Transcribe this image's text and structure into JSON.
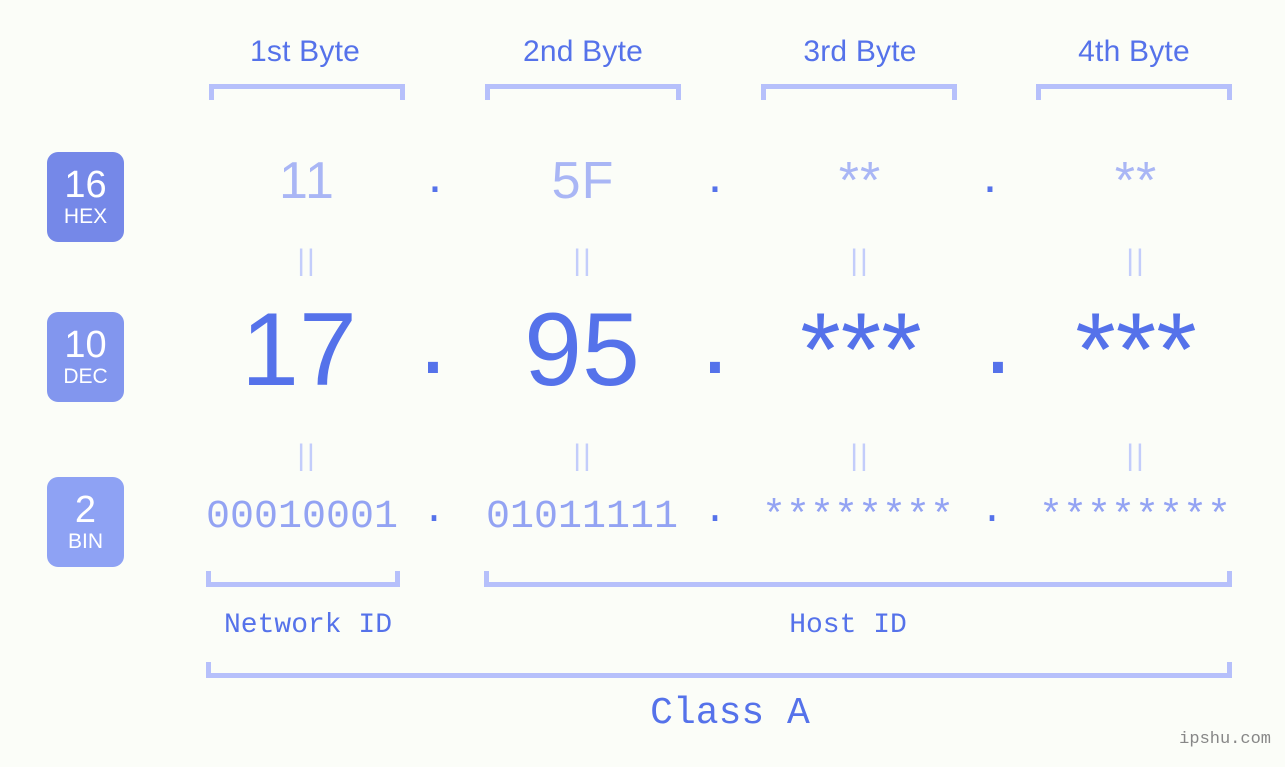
{
  "colors": {
    "background": "#fbfdf8",
    "accent": "#5572ea",
    "accent_light": "#a9b6f5",
    "bracket": "#b6c0fb",
    "connector": "#c3cdfb",
    "badge_hex": "#7588e8",
    "badge_dec": "#8296ee",
    "badge_bin": "#8ea2f4",
    "watermark": "#878787"
  },
  "byte_headers": [
    {
      "label": "1st Byte"
    },
    {
      "label": "2nd Byte"
    },
    {
      "label": "3rd Byte"
    },
    {
      "label": "4th Byte"
    }
  ],
  "rows": [
    {
      "id": "hex",
      "badge_number": "16",
      "badge_label": "HEX",
      "values": [
        "11",
        "5F",
        "**",
        "**"
      ],
      "separator": "."
    },
    {
      "id": "dec",
      "badge_number": "10",
      "badge_label": "DEC",
      "values": [
        "17",
        "95",
        "***",
        "***"
      ],
      "separator": "."
    },
    {
      "id": "bin",
      "badge_number": "2",
      "badge_label": "BIN",
      "values": [
        "00010001",
        "01011111",
        "********",
        "********"
      ],
      "separator": "."
    }
  ],
  "connectors": {
    "symbol": "||"
  },
  "sections": [
    {
      "label": "Network ID"
    },
    {
      "label": "Host ID"
    }
  ],
  "class": {
    "label": "Class A"
  },
  "watermark": {
    "text": "ipshu.com"
  }
}
